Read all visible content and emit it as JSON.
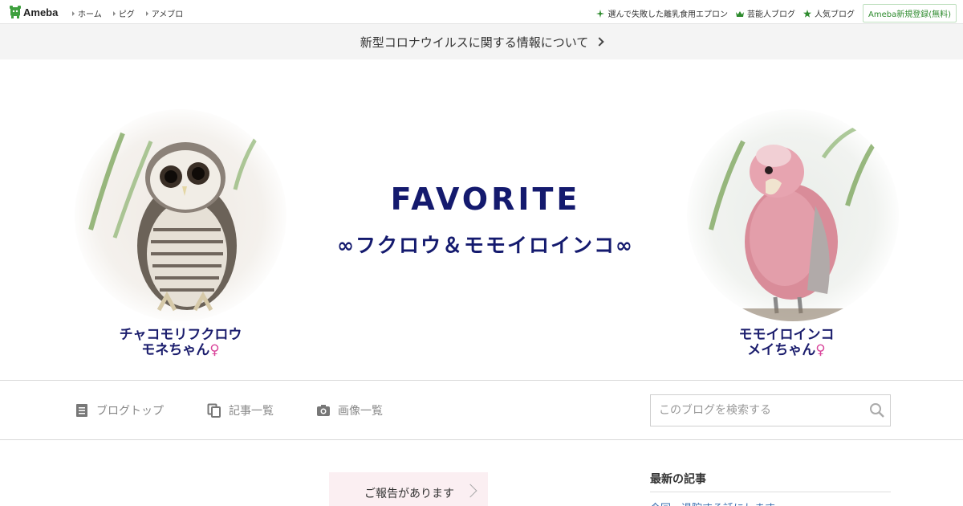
{
  "topbar": {
    "logo_text": "Ameba",
    "nav": [
      "ホーム",
      "ピグ",
      "アメブロ"
    ],
    "links": [
      {
        "label": "選んで失敗した離乳食用エプロン",
        "icon": "sparkle-icon"
      },
      {
        "label": "芸能人ブログ",
        "icon": "crown-icon"
      },
      {
        "label": "人気ブログ",
        "icon": "star-icon"
      }
    ],
    "register_label": "Ameba新規登録(無料)"
  },
  "notice": {
    "text": "新型コロナウイルスに関する情報について"
  },
  "banner": {
    "title": "FAVORITE",
    "subtitle": "∞フクロウ＆モモイロインコ∞",
    "left_caption_line1": "チャコモリフクロウ",
    "left_caption_line2": "モネちゃん",
    "right_caption_line1": "モモイロインコ",
    "right_caption_line2": "メイちゃん",
    "female_symbol": "♀"
  },
  "nav": {
    "items": [
      {
        "label": "ブログトップ",
        "icon": "document-icon"
      },
      {
        "label": "記事一覧",
        "icon": "copy-icon"
      },
      {
        "label": "画像一覧",
        "icon": "camera-icon"
      }
    ],
    "search_placeholder": "このブログを検索する"
  },
  "content": {
    "report_label": "ご報告があります",
    "sidebar_title": "最新の記事",
    "sidebar_first_item": "今回、退院する話にします"
  },
  "colors": {
    "accent_green": "#2e8b2e",
    "banner_text": "#141a6e",
    "report_bg": "#fbeff2"
  }
}
